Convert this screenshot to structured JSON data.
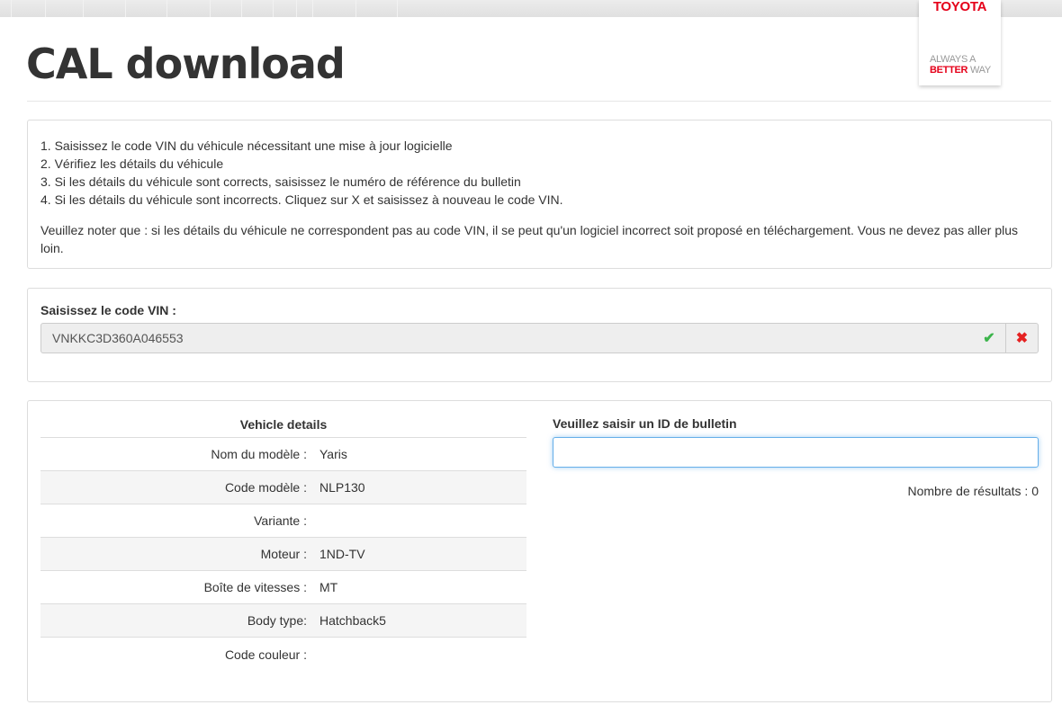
{
  "header": {
    "title": "CAL download",
    "logo": {
      "brand": "TOYOTA",
      "tagline_1": "ALWAYS A",
      "tagline_2_red": "BETTER",
      "tagline_2": "WAY"
    }
  },
  "instructions": {
    "steps": [
      "1. Saisissez le code VIN du véhicule nécessitant une mise à jour logicielle",
      "2. Vérifiez les détails du véhicule",
      "3. Si les détails du véhicule sont corrects, saisissez le numéro de référence du bulletin",
      "4. Si les détails du véhicule sont incorrects. Cliquez sur X et saisissez à nouveau le code VIN."
    ],
    "note": "Veuillez noter que : si les détails du véhicule ne correspondent pas au code VIN, il se peut qu'un logiciel incorrect soit proposé en téléchargement. Vous ne devez pas aller plus loin."
  },
  "vin": {
    "label": "Saisissez le code VIN :",
    "value": "VNKKC3D360A046553"
  },
  "vehicle": {
    "title": "Vehicle details",
    "rows": [
      {
        "k": "Nom du modèle :",
        "v": "Yaris"
      },
      {
        "k": "Code modèle :",
        "v": "NLP130"
      },
      {
        "k": "Variante :",
        "v": ""
      },
      {
        "k": "Moteur :",
        "v": "1ND-TV"
      },
      {
        "k": "Boîte de vitesses :",
        "v": "MT"
      },
      {
        "k": "Body type:",
        "v": "Hatchback5"
      },
      {
        "k": "Code couleur :",
        "v": ""
      }
    ]
  },
  "bulletin": {
    "label": "Veuillez saisir un ID de bulletin",
    "value": "",
    "results": "Nombre de résultats : 0"
  }
}
